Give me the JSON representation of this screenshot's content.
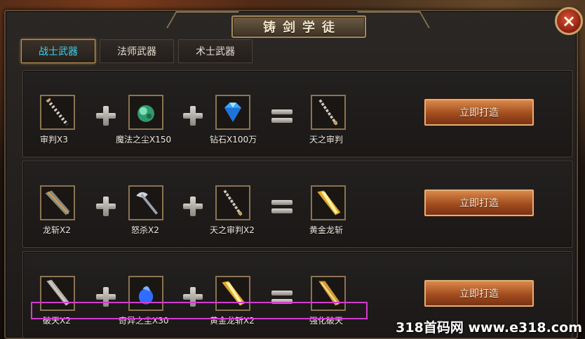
{
  "window": {
    "title": "铸剑学徒",
    "close_glyph": "×"
  },
  "tabs": [
    {
      "label": "战士武器",
      "active": true
    },
    {
      "label": "法师武器",
      "active": false
    },
    {
      "label": "术士武器",
      "active": false
    }
  ],
  "recipes": [
    {
      "inputs": [
        {
          "name": "审判X3",
          "icon": "judgement-sword-icon"
        },
        {
          "name": "魔法之尘X150",
          "icon": "magic-dust-icon"
        },
        {
          "name": "钻石X100万",
          "icon": "diamond-icon"
        }
      ],
      "output": {
        "name": "天之审判",
        "icon": "heaven-judgement-sword-icon"
      },
      "button": "立即打造"
    },
    {
      "inputs": [
        {
          "name": "龙斩X2",
          "icon": "dragon-blade-icon"
        },
        {
          "name": "怒杀X2",
          "icon": "rage-kill-axe-icon"
        },
        {
          "name": "天之审判X2",
          "icon": "heaven-judgement-sword-icon"
        }
      ],
      "output": {
        "name": "黄金龙斩",
        "icon": "golden-dragon-blade-icon"
      },
      "button": "立即打造"
    },
    {
      "inputs": [
        {
          "name": "破天X2",
          "icon": "sky-breaker-sword-icon"
        },
        {
          "name": "奇异之尘X30",
          "icon": "strange-dust-icon"
        },
        {
          "name": "黄金龙斩X2",
          "icon": "golden-dragon-blade-icon"
        }
      ],
      "output": {
        "name": "强化破天",
        "icon": "enhanced-sky-breaker-icon"
      },
      "button": "立即打造"
    }
  ],
  "watermark": "318首码网 www.e318.com",
  "colors": {
    "active_tab_text": "#3ed0f0",
    "highlight_border": "#d43bd2",
    "button": "#b25a26"
  }
}
